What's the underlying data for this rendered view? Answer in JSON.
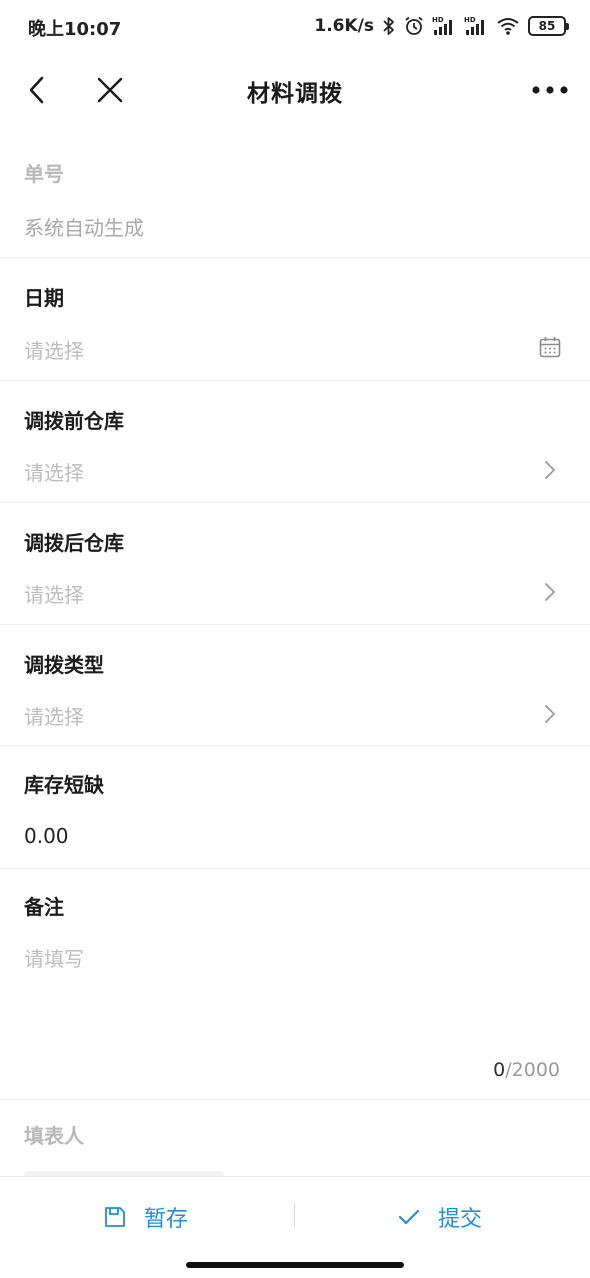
{
  "status_bar": {
    "time": "晚上10:07",
    "speed": "1.6K/s",
    "battery": "85"
  },
  "header": {
    "title": "材料调拨"
  },
  "form": {
    "order_no": {
      "label": "单号",
      "value": "系统自动生成"
    },
    "date": {
      "label": "日期",
      "placeholder": "请选择"
    },
    "warehouse_before": {
      "label": "调拨前仓库",
      "placeholder": "请选择"
    },
    "warehouse_after": {
      "label": "调拨后仓库",
      "placeholder": "请选择"
    },
    "transfer_type": {
      "label": "调拨类型",
      "placeholder": "请选择"
    },
    "shortage": {
      "label": "库存短缺",
      "value": "0.00"
    },
    "remark": {
      "label": "备注",
      "placeholder": "请填写",
      "count": "0",
      "max": "/2000"
    },
    "filler": {
      "label": "填表人"
    }
  },
  "actions": {
    "save_label": "暂存",
    "submit_label": "提交"
  },
  "colors": {
    "accent": "#1f8fd6",
    "placeholder": "#bdbdbd",
    "divider": "#ececec"
  },
  "icons": [
    "back-arrow-icon",
    "close-icon",
    "more-dots-icon",
    "calendar-icon",
    "chevron-right-icon",
    "save-icon",
    "check-icon"
  ]
}
